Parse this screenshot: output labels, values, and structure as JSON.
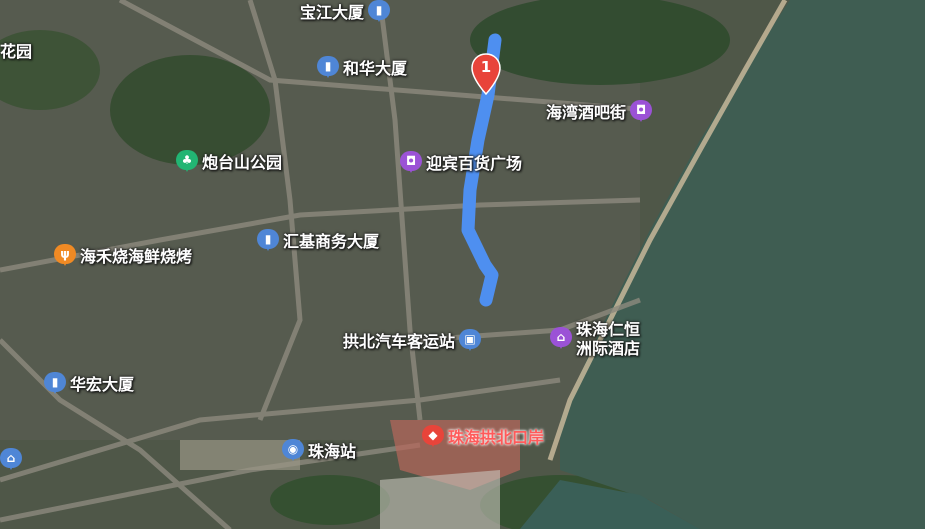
{
  "map": {
    "route_marker_number": "1",
    "colors": {
      "route": "#4e8ff0",
      "water": "#3f5d52",
      "marker": "#e8443a"
    }
  },
  "pois": {
    "baojiang": {
      "label": "宝江大厦",
      "icon": "building-icon"
    },
    "hehua": {
      "label": "和华大厦",
      "icon": "building-icon"
    },
    "haiwan": {
      "label": "海湾酒吧街",
      "icon": "shopping-icon"
    },
    "huayuan": {
      "label": "花园"
    },
    "paotaishan": {
      "label": "炮台山公园",
      "icon": "park-icon"
    },
    "yingbin": {
      "label": "迎宾百货广场",
      "icon": "shopping-icon"
    },
    "huiji": {
      "label": "汇基商务大厦",
      "icon": "building-icon"
    },
    "haihe": {
      "label": "海禾烧海鲜烧烤",
      "icon": "food-icon"
    },
    "gongbei_bus": {
      "label": "拱北汽车客运站",
      "icon": "bus-icon"
    },
    "renheng_1": {
      "label": "珠海仁恒",
      "label_2": "洲际酒店",
      "icon": "hotel-icon"
    },
    "huahong": {
      "label": "华宏大厦",
      "icon": "building-icon"
    },
    "zhuhai_station": {
      "label": "珠海站",
      "icon": "train-station-icon"
    },
    "gongbei_port": {
      "label": "珠海拱北口岸",
      "icon": "port-icon"
    }
  }
}
